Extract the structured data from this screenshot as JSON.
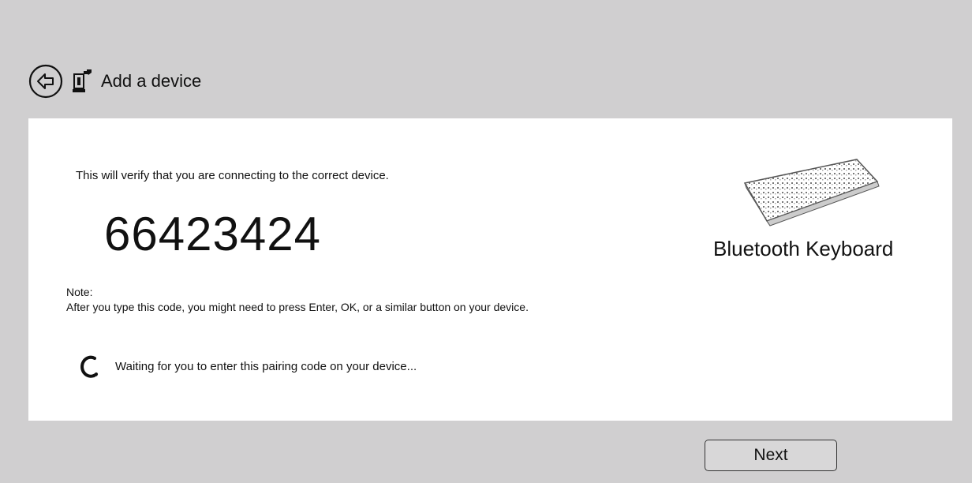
{
  "header": {
    "title": "Add a device",
    "back_icon": "back-arrow-icon",
    "device_icon": "add-device-icon"
  },
  "main": {
    "verify_text": "This will verify that you are connecting to the correct device.",
    "pairing_code": "66423424",
    "note_label": "Note:",
    "note_body": "After you type this code, you might need to press Enter, OK, or a similar button on your device.",
    "waiting_text": "Waiting for you to enter this pairing code on your device...",
    "spinner_icon": "spinner-icon"
  },
  "device": {
    "name": "Bluetooth Keyboard",
    "image_icon": "keyboard-icon"
  },
  "footer": {
    "next_label": "Next"
  },
  "colors": {
    "background": "#d0cfd0",
    "panel": "#ffffff",
    "text": "#111111"
  }
}
